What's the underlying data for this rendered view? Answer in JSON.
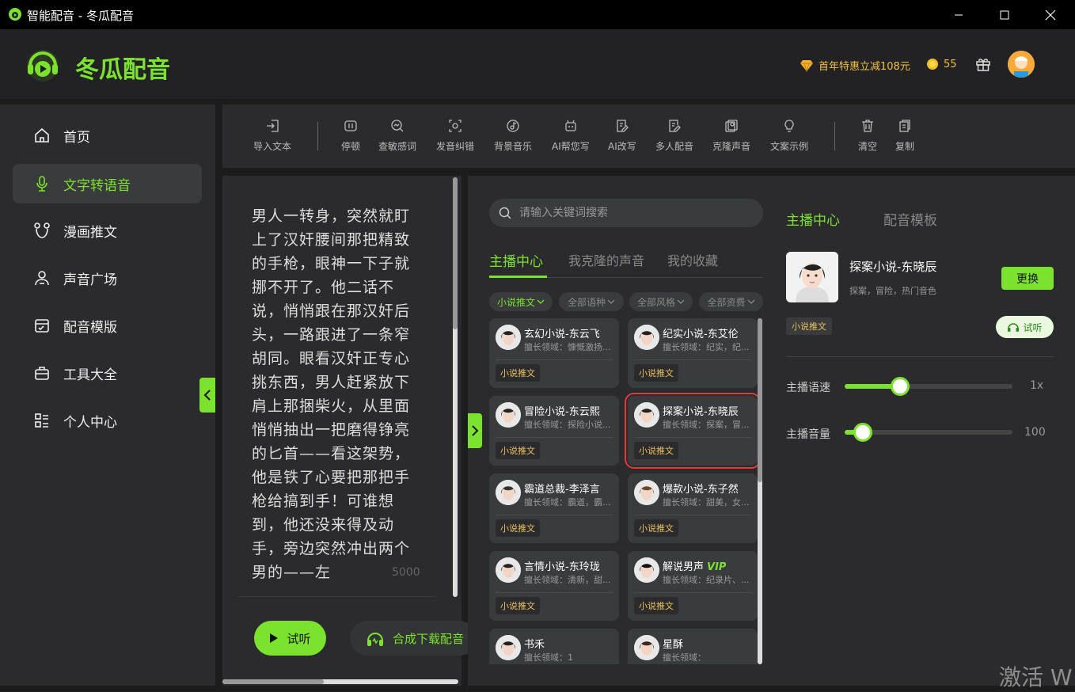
{
  "window": {
    "title": "智能配音 - 冬瓜配音",
    "icon": "app-icon"
  },
  "header": {
    "brand": "冬瓜配音",
    "promo": "首年特惠立减108元",
    "coins": "55",
    "icons": [
      "diamond-icon",
      "coin-icon",
      "gift-icon",
      "avatar"
    ]
  },
  "sidebar": {
    "items": [
      {
        "label": "首页",
        "icon": "home-icon"
      },
      {
        "label": "文字转语音",
        "icon": "microphone-icon",
        "active": true
      },
      {
        "label": "漫画推文",
        "icon": "bear-icon"
      },
      {
        "label": "声音广场",
        "icon": "people-icon"
      },
      {
        "label": "配音模版",
        "icon": "template-icon"
      },
      {
        "label": "工具大全",
        "icon": "toolbox-icon"
      },
      {
        "label": "个人中心",
        "icon": "list-icon"
      }
    ]
  },
  "toolbar": {
    "items": [
      {
        "label": "导入文本",
        "icon": "import-icon"
      },
      {
        "label": "停顿",
        "icon": "pause-icon"
      },
      {
        "label": "查敏感词",
        "icon": "search-sensitive-icon"
      },
      {
        "label": "发音纠错",
        "icon": "pronunciation-icon"
      },
      {
        "label": "背景音乐",
        "icon": "music-icon"
      },
      {
        "label": "AI帮您写",
        "icon": "robot-icon"
      },
      {
        "label": "AI改写",
        "icon": "rewrite-icon"
      },
      {
        "label": "多人配音",
        "icon": "multi-voice-icon"
      },
      {
        "label": "克隆声音",
        "icon": "clone-icon"
      },
      {
        "label": "文案示例",
        "icon": "bulb-icon"
      },
      {
        "label": "清空",
        "icon": "trash-icon"
      },
      {
        "label": "复制",
        "icon": "copy-icon"
      }
    ]
  },
  "editor": {
    "text": "男人一转身，突然就盯上了汉奸腰间那把精致的手枪，眼神一下子就挪不开了。他二话不说，悄悄跟在那汉奸后头，一路跟进了一条窄胡同。眼看汉奸正专心挑东西，男人赶紧放下肩上那捆柴火，从里面悄悄抽出一把磨得铮亮的匕首——看这架势，他是铁了心要把那把手枪给搞到手！可谁想到，他还没来得及动手，旁边突然冲出两个男的——左",
    "counter": "5000",
    "preview_label": "试听",
    "download_label": "合成下载配音"
  },
  "voices": {
    "search_placeholder": "请输入关键词搜索",
    "tabs": [
      "主播中心",
      "我克隆的声音",
      "我的收藏"
    ],
    "filters": [
      "小说推文",
      "全部语种",
      "全部风格",
      "全部资费"
    ],
    "cards": [
      {
        "name": "玄幻小说-东云飞",
        "desc": "擅长领域：慷慨激扬...",
        "tag": "小说推文",
        "vip": ""
      },
      {
        "name": "纪实小说-东艾伦",
        "desc": "擅长领域：纪实，纪...",
        "tag": "小说推文",
        "vip": ""
      },
      {
        "name": "冒险小说-东云熙",
        "desc": "擅长领域：探险小说...",
        "tag": "小说推文",
        "vip": ""
      },
      {
        "name": "探案小说-东晓辰",
        "desc": "擅长领域：探案，冒...",
        "tag": "小说推文",
        "vip": "",
        "selected": true
      },
      {
        "name": "霸道总裁-李泽言",
        "desc": "擅长领域：霸道，霸...",
        "tag": "小说推文",
        "vip": ""
      },
      {
        "name": "爆款小说-东子然",
        "desc": "擅长领域：甜美，女...",
        "tag": "小说推文",
        "vip": ""
      },
      {
        "name": "言情小说-东玲珑",
        "desc": "擅长领域：清新，甜...",
        "tag": "小说推文",
        "vip": ""
      },
      {
        "name": "解说男声",
        "desc": "擅长领域：纪录片、...",
        "tag": "小说推文",
        "vip": "VIP"
      },
      {
        "name": "书禾",
        "desc": "擅长领域：1",
        "tag": "",
        "vip": ""
      },
      {
        "name": "星酥",
        "desc": "擅长领域：",
        "tag": "",
        "vip": ""
      }
    ]
  },
  "anchor": {
    "tabs": [
      "主播中心",
      "配音模板"
    ],
    "name": "探案小说-东晓辰",
    "desc": "探案，冒险，热门音色",
    "tag": "小说推文",
    "change_label": "更换",
    "try_label": "试听",
    "speed_label": "主播语速",
    "speed_value": "1x",
    "speed_level": 0.33,
    "volume_label": "主播音量",
    "volume_value": "100",
    "volume_level": 0.11
  },
  "watermark": "激活 W",
  "colors": {
    "accent": "#7be22e",
    "bg": "#1c1c1c",
    "panel": "#2b2b2d",
    "card": "#3a3b3d",
    "tag": "#e8c060",
    "selected": "#e03a3a"
  }
}
